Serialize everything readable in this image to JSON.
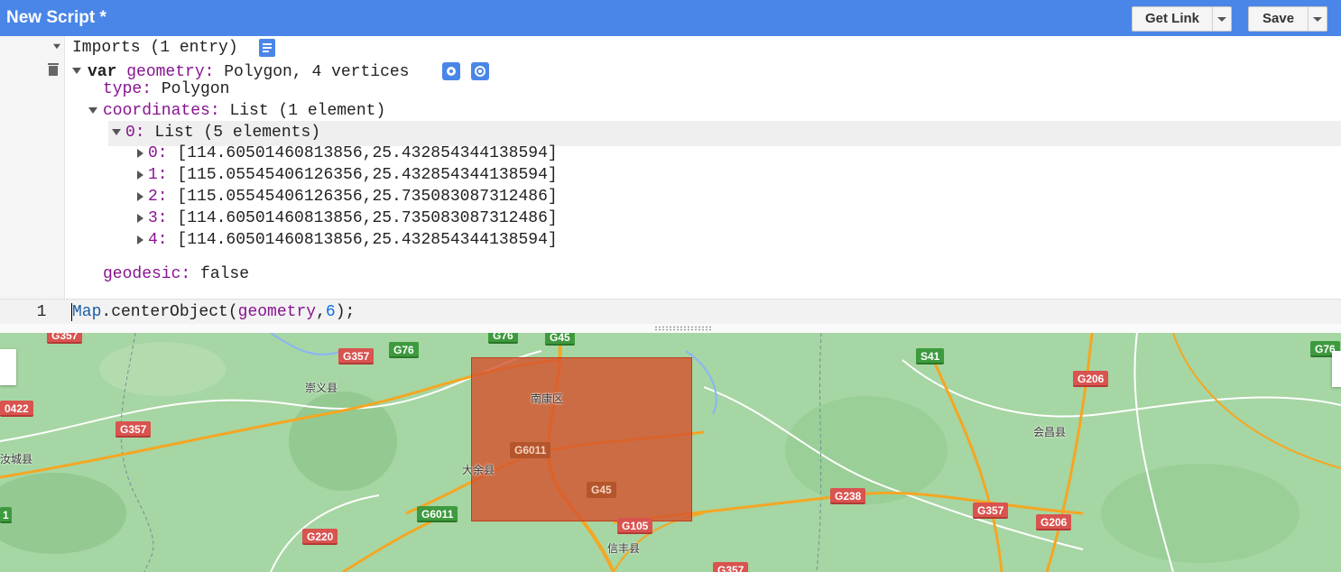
{
  "header": {
    "title": "New Script *",
    "get_link_label": "Get Link",
    "save_label": "Save"
  },
  "imports": {
    "summary": "Imports (1 entry)",
    "var_keyword": "var",
    "var_name": "geometry:",
    "var_summary": "Polygon, 4 vertices",
    "type_key": "type:",
    "type_value": "Polygon",
    "coords_key": "coordinates:",
    "coords_value": "List (1 element)",
    "list_key": "0:",
    "list_value": "List (5 elements)",
    "points": [
      {
        "key": "0:",
        "value": "[114.60501460813856,25.432854344138594]"
      },
      {
        "key": "1:",
        "value": "[115.05545406126356,25.432854344138594]"
      },
      {
        "key": "2:",
        "value": "[115.05545406126356,25.735083087312486]"
      },
      {
        "key": "3:",
        "value": "[114.60501460813856,25.735083087312486]"
      },
      {
        "key": "4:",
        "value": "[114.60501460813856,25.432854344138594]"
      }
    ],
    "geodesic_key": "geodesic:",
    "geodesic_value": "false"
  },
  "editor": {
    "line_number": "1",
    "code_obj": "Map",
    "code_method": ".centerObject(",
    "code_arg": "geometry",
    "code_comma": ",",
    "code_num": "6",
    "code_end": ");"
  },
  "map": {
    "places": {
      "chongyi": "崇义县",
      "nankang": "南康区",
      "dayu": "大余县",
      "xinfeng": "信丰县",
      "huichang": "会昌县",
      "rucheng": "汝城县"
    },
    "roads": {
      "g357a": "G357",
      "g76a": "G76",
      "g76top": "G76",
      "g45top": "G45",
      "g357left": "G357",
      "g0422": "0422",
      "g6011a": "G6011",
      "g45": "G45",
      "g6011b": "G6011",
      "g220": "G220",
      "g105": "G105",
      "g357bottom": "G357",
      "s41": "S41",
      "g206a": "G206",
      "g238": "G238",
      "g357right": "G357",
      "g206b": "G206",
      "g76right": "G76",
      "l1": "1"
    },
    "colors": {
      "polygon": "#d45430",
      "terrain": "#a6d6a3",
      "highway": "#f5a623"
    }
  }
}
